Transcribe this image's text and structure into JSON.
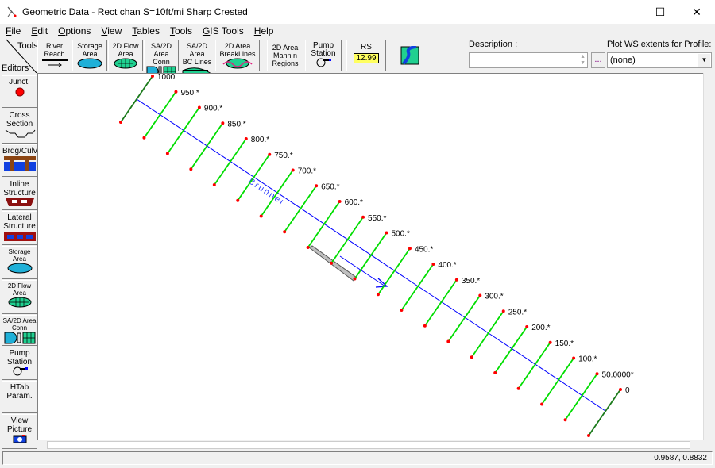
{
  "window": {
    "title": "Geometric Data - Rect chan S=10ft/mi Sharp Crested",
    "minimize": "—",
    "maximize": "☐",
    "close": "✕"
  },
  "menu": [
    "File",
    "Edit",
    "Options",
    "View",
    "Tables",
    "Tools",
    "GIS Tools",
    "Help"
  ],
  "toolbar": {
    "tools_label": "Tools",
    "editors_label": "Editors",
    "buttons": [
      {
        "l1": "River",
        "l2": "Reach"
      },
      {
        "l1": "Storage",
        "l2": "Area"
      },
      {
        "l1": "2D Flow",
        "l2": "Area"
      },
      {
        "l1": "SA/2D Area",
        "l2": "Conn"
      },
      {
        "l1": "SA/2D Area",
        "l2": "BC Lines"
      },
      {
        "l1": "2D Area",
        "l2": "BreakLines"
      },
      {
        "l1": "2D Area",
        "l2": "Mann n",
        "l3": "Regions"
      },
      {
        "l1": "Pump",
        "l2": "Station"
      },
      {
        "l1": "RS",
        "l2": "12.99"
      }
    ],
    "map_icon": "map-layers-icon"
  },
  "description": {
    "label": "Description :",
    "value": "",
    "browse": "..."
  },
  "plot_ws": {
    "label": "Plot WS extents for Profile:",
    "selected": "(none)"
  },
  "editors": [
    {
      "l1": "Junct.",
      "icon": "junction-icon"
    },
    {
      "l1": "Cross",
      "l2": "Section",
      "icon": "cross-section-icon"
    },
    {
      "l1": "Brdg/Culv",
      "icon": "bridge-culvert-icon"
    },
    {
      "l1": "Inline",
      "l2": "Structure",
      "icon": "inline-structure-icon"
    },
    {
      "l1": "Lateral",
      "l2": "Structure",
      "icon": "lateral-structure-icon"
    },
    {
      "l1": "Storage",
      "l2": "Area",
      "icon": "storage-area-icon"
    },
    {
      "l1": "2D Flow",
      "l2": "Area",
      "icon": "2d-flow-area-icon"
    },
    {
      "l1": "SA/2D Area",
      "l2": "Conn",
      "icon": "sa-2d-conn-icon"
    },
    {
      "l1": "Pump",
      "l2": "Station",
      "icon": "pump-icon"
    },
    {
      "l1": "HTab",
      "l2": "Param."
    },
    {
      "l1": "View",
      "l2": "Picture",
      "icon": "camera-icon"
    }
  ],
  "schematic": {
    "river_label": "Brunner",
    "cross_sections": [
      "1000",
      "950.*",
      "900.*",
      "850.*",
      "800.*",
      "750.*",
      "700.*",
      "650.*",
      "600.*",
      "550.*",
      "500.*",
      "450.*",
      "400.*",
      "350.*",
      "300.*",
      "250.*",
      "200.*",
      "150.*",
      "100.*",
      "50.0000*",
      "0"
    ],
    "colors": {
      "xs": "#00dd00",
      "xs_end": "#1a7a1a",
      "river": "#0000ff",
      "point": "#ff0000",
      "structure": "#c0c0c0"
    }
  },
  "status": {
    "coords": "0.9587, 0.8832"
  }
}
